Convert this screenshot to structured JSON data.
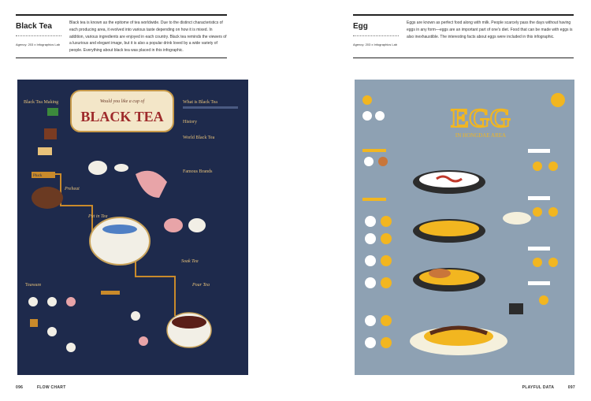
{
  "left_page": {
    "title": "Black Tea",
    "agency": "Agency: 203 x Infographics Lab",
    "description": "Black tea is known as the epitome of tea worldwide. Due to the distinct characteristics of each producing area, it evolved into various taste depending on how it is mixed. In addition, various ingredients are enjoyed in each country. Black tea reminds the viewers of a luxurious and elegant image, but it is also a popular drink loved by a wide variety of people. Everything about black tea was placed in this infographic.",
    "poster": {
      "tagline": "Would you like a cup of",
      "headline": "BLACK TEA",
      "labels": [
        "Black Tea Making",
        "What is Black Tea",
        "History",
        "World Black Tea",
        "Famous Brands",
        "Pluck",
        "Preheat",
        "Put in Tea",
        "Steep Tea",
        "Soak Tea",
        "Pour Tea",
        "Teaware"
      ]
    },
    "footer": {
      "page_no": "096",
      "section": "FLOW CHART"
    }
  },
  "right_page": {
    "title": "Egg",
    "agency": "Agency: 203 x Infographics Lab",
    "description": "Eggs are known as perfect food along with milk. People scarcely pass the days without having eggs in any form—eggs are an important part of one's diet. Food that can be made with eggs is also inexhaustible. The interesting facts about eggs were included in this infographic.",
    "poster": {
      "headline": "EGG",
      "subheading": "IN HONGDAE AREA"
    },
    "footer": {
      "page_no": "097",
      "section": "PLAYFUL DATA"
    }
  },
  "colors": {
    "black_tea_bg": "#1e2a4c",
    "egg_bg": "#8ea1b3",
    "yolk": "#f2b620",
    "plaque": "#f3e6c8",
    "plaque_text": "#9e2a2b"
  }
}
